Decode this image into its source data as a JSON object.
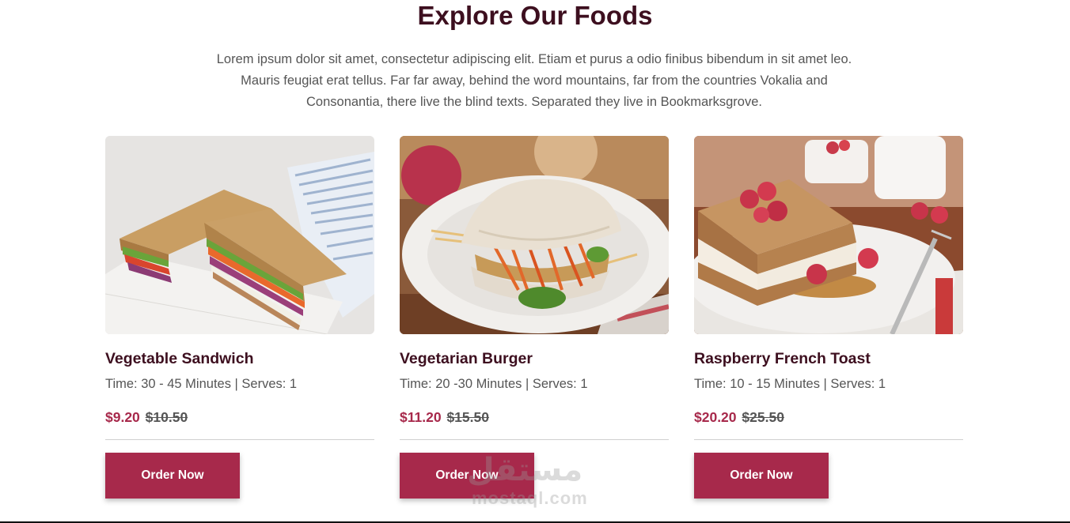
{
  "section": {
    "title": "Explore Our Foods",
    "description": "Lorem ipsum dolor sit amet, consectetur adipiscing elit. Etiam et purus a odio finibus bibendum in sit amet leo. Mauris feugiat erat tellus. Far far away, behind the word mountains, far from the countries Vokalia and Consonantia, there live the blind texts. Separated they live in Bookmarksgrove."
  },
  "cards": [
    {
      "title": "Vegetable Sandwich",
      "meta": "Time: 30 - 45 Minutes | Serves: 1",
      "price_new": "$9.20",
      "price_old": "$10.50",
      "button_label": "Order Now",
      "image": "vegetable-sandwich-photo"
    },
    {
      "title": "Vegetarian Burger",
      "meta": "Time: 20 -30 Minutes | Serves: 1",
      "price_new": "$11.20",
      "price_old": "$15.50",
      "button_label": "Order Now",
      "image": "vegetarian-burger-photo"
    },
    {
      "title": "Raspberry French Toast",
      "meta": "Time: 10 - 15 Minutes | Serves: 1",
      "price_new": "$20.20",
      "price_old": "$25.50",
      "button_label": "Order Now",
      "image": "raspberry-french-toast-photo"
    }
  ],
  "watermark": {
    "arabic": "مستقل",
    "latin": "mostaql.com"
  },
  "colors": {
    "title": "#3d0f1f",
    "accent": "#a7294b",
    "text": "#555555"
  }
}
